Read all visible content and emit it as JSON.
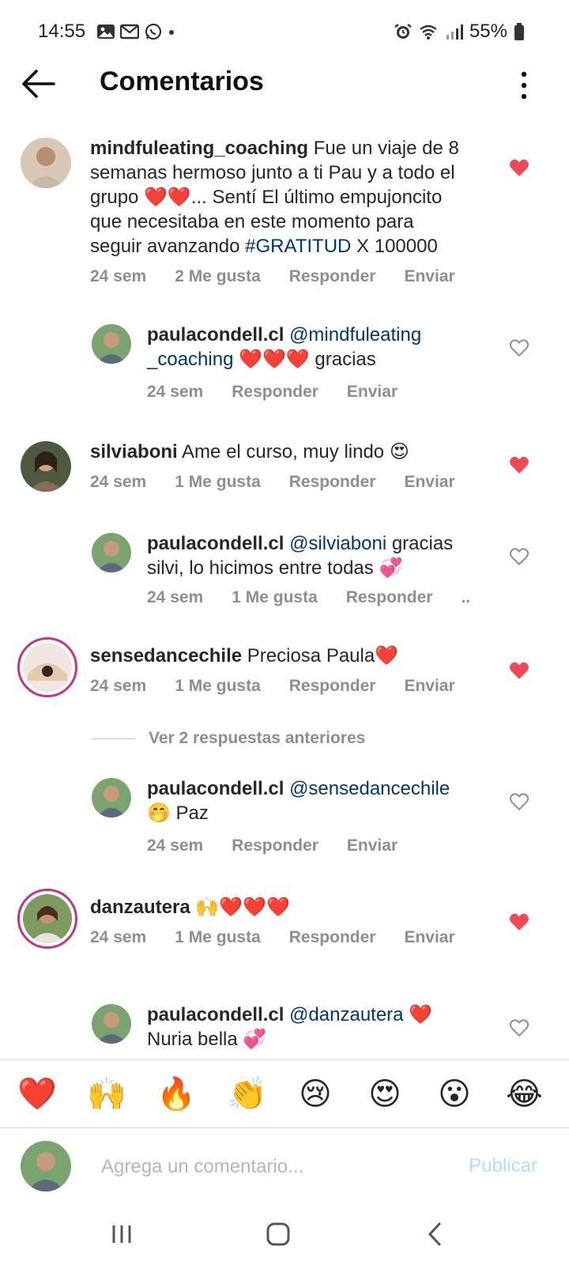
{
  "status": {
    "time": "14:55",
    "battery": "55%"
  },
  "header": {
    "title": "Comentarios"
  },
  "comments": [
    {
      "username": "mindfuleating_coaching",
      "text_lines": [
        "Fue un viaje de 8",
        "semanas hermoso junto a ti Pau y a todo el",
        "grupo ❤️❤️... Sentí El último empujoncito",
        "que necesitaba en este momento para",
        "seguir avanzando"
      ],
      "hashtag": "#GRATITUD",
      "tail": "X 100000",
      "time": "24 sem",
      "likes": "2 Me gusta",
      "reply": "Responder",
      "send": "Enviar"
    },
    {
      "username": "paulacondell.cl",
      "mention": "@mindfuleating",
      "mention2": "_coaching",
      "text": "❤️❤️❤️ gracias",
      "time": "24 sem",
      "reply": "Responder",
      "send": "Enviar"
    },
    {
      "username": "silviaboni",
      "text": "Ame el curso, muy lindo 😍",
      "time": "24 sem",
      "likes": "1 Me gusta",
      "reply": "Responder",
      "send": "Enviar"
    },
    {
      "username": "paulacondell.cl",
      "mention": "@silviaboni",
      "text": "gracias",
      "text2": "silvi,  lo hicimos entre todas 💞",
      "time": "24 sem",
      "likes": "1 Me gusta",
      "reply": "Responder",
      "more": ".."
    },
    {
      "username": "sensedancechile",
      "text": "Preciosa Paula❤️",
      "time": "24 sem",
      "likes": "1 Me gusta",
      "reply": "Responder",
      "send": "Enviar"
    },
    {
      "view_previous": "Ver 2 respuestas anteriores"
    },
    {
      "username": "paulacondell.cl",
      "mention": "@sensedancechile",
      "text": "🤭 Paz",
      "time": "24 sem",
      "reply": "Responder",
      "send": "Enviar"
    },
    {
      "username": "danzautera",
      "text": "🙌❤️❤️❤️",
      "time": "24 sem",
      "likes": "1 Me gusta",
      "reply": "Responder",
      "send": "Enviar"
    },
    {
      "username": "paulacondell.cl",
      "mention": "@danzautera",
      "text": "❤️",
      "text2": "Nuria bella 💞"
    }
  ],
  "emoji_bar": [
    "❤️",
    "🙌",
    "🔥",
    "👏",
    "😢",
    "😍",
    "😮",
    "😂"
  ],
  "composer": {
    "placeholder": "Agrega un comentario...",
    "publish": "Publicar"
  },
  "colors": {
    "liked": "#ed4956",
    "link": "#00376b",
    "muted": "#8e8e8e",
    "publish_disabled": "#b3dbff"
  }
}
